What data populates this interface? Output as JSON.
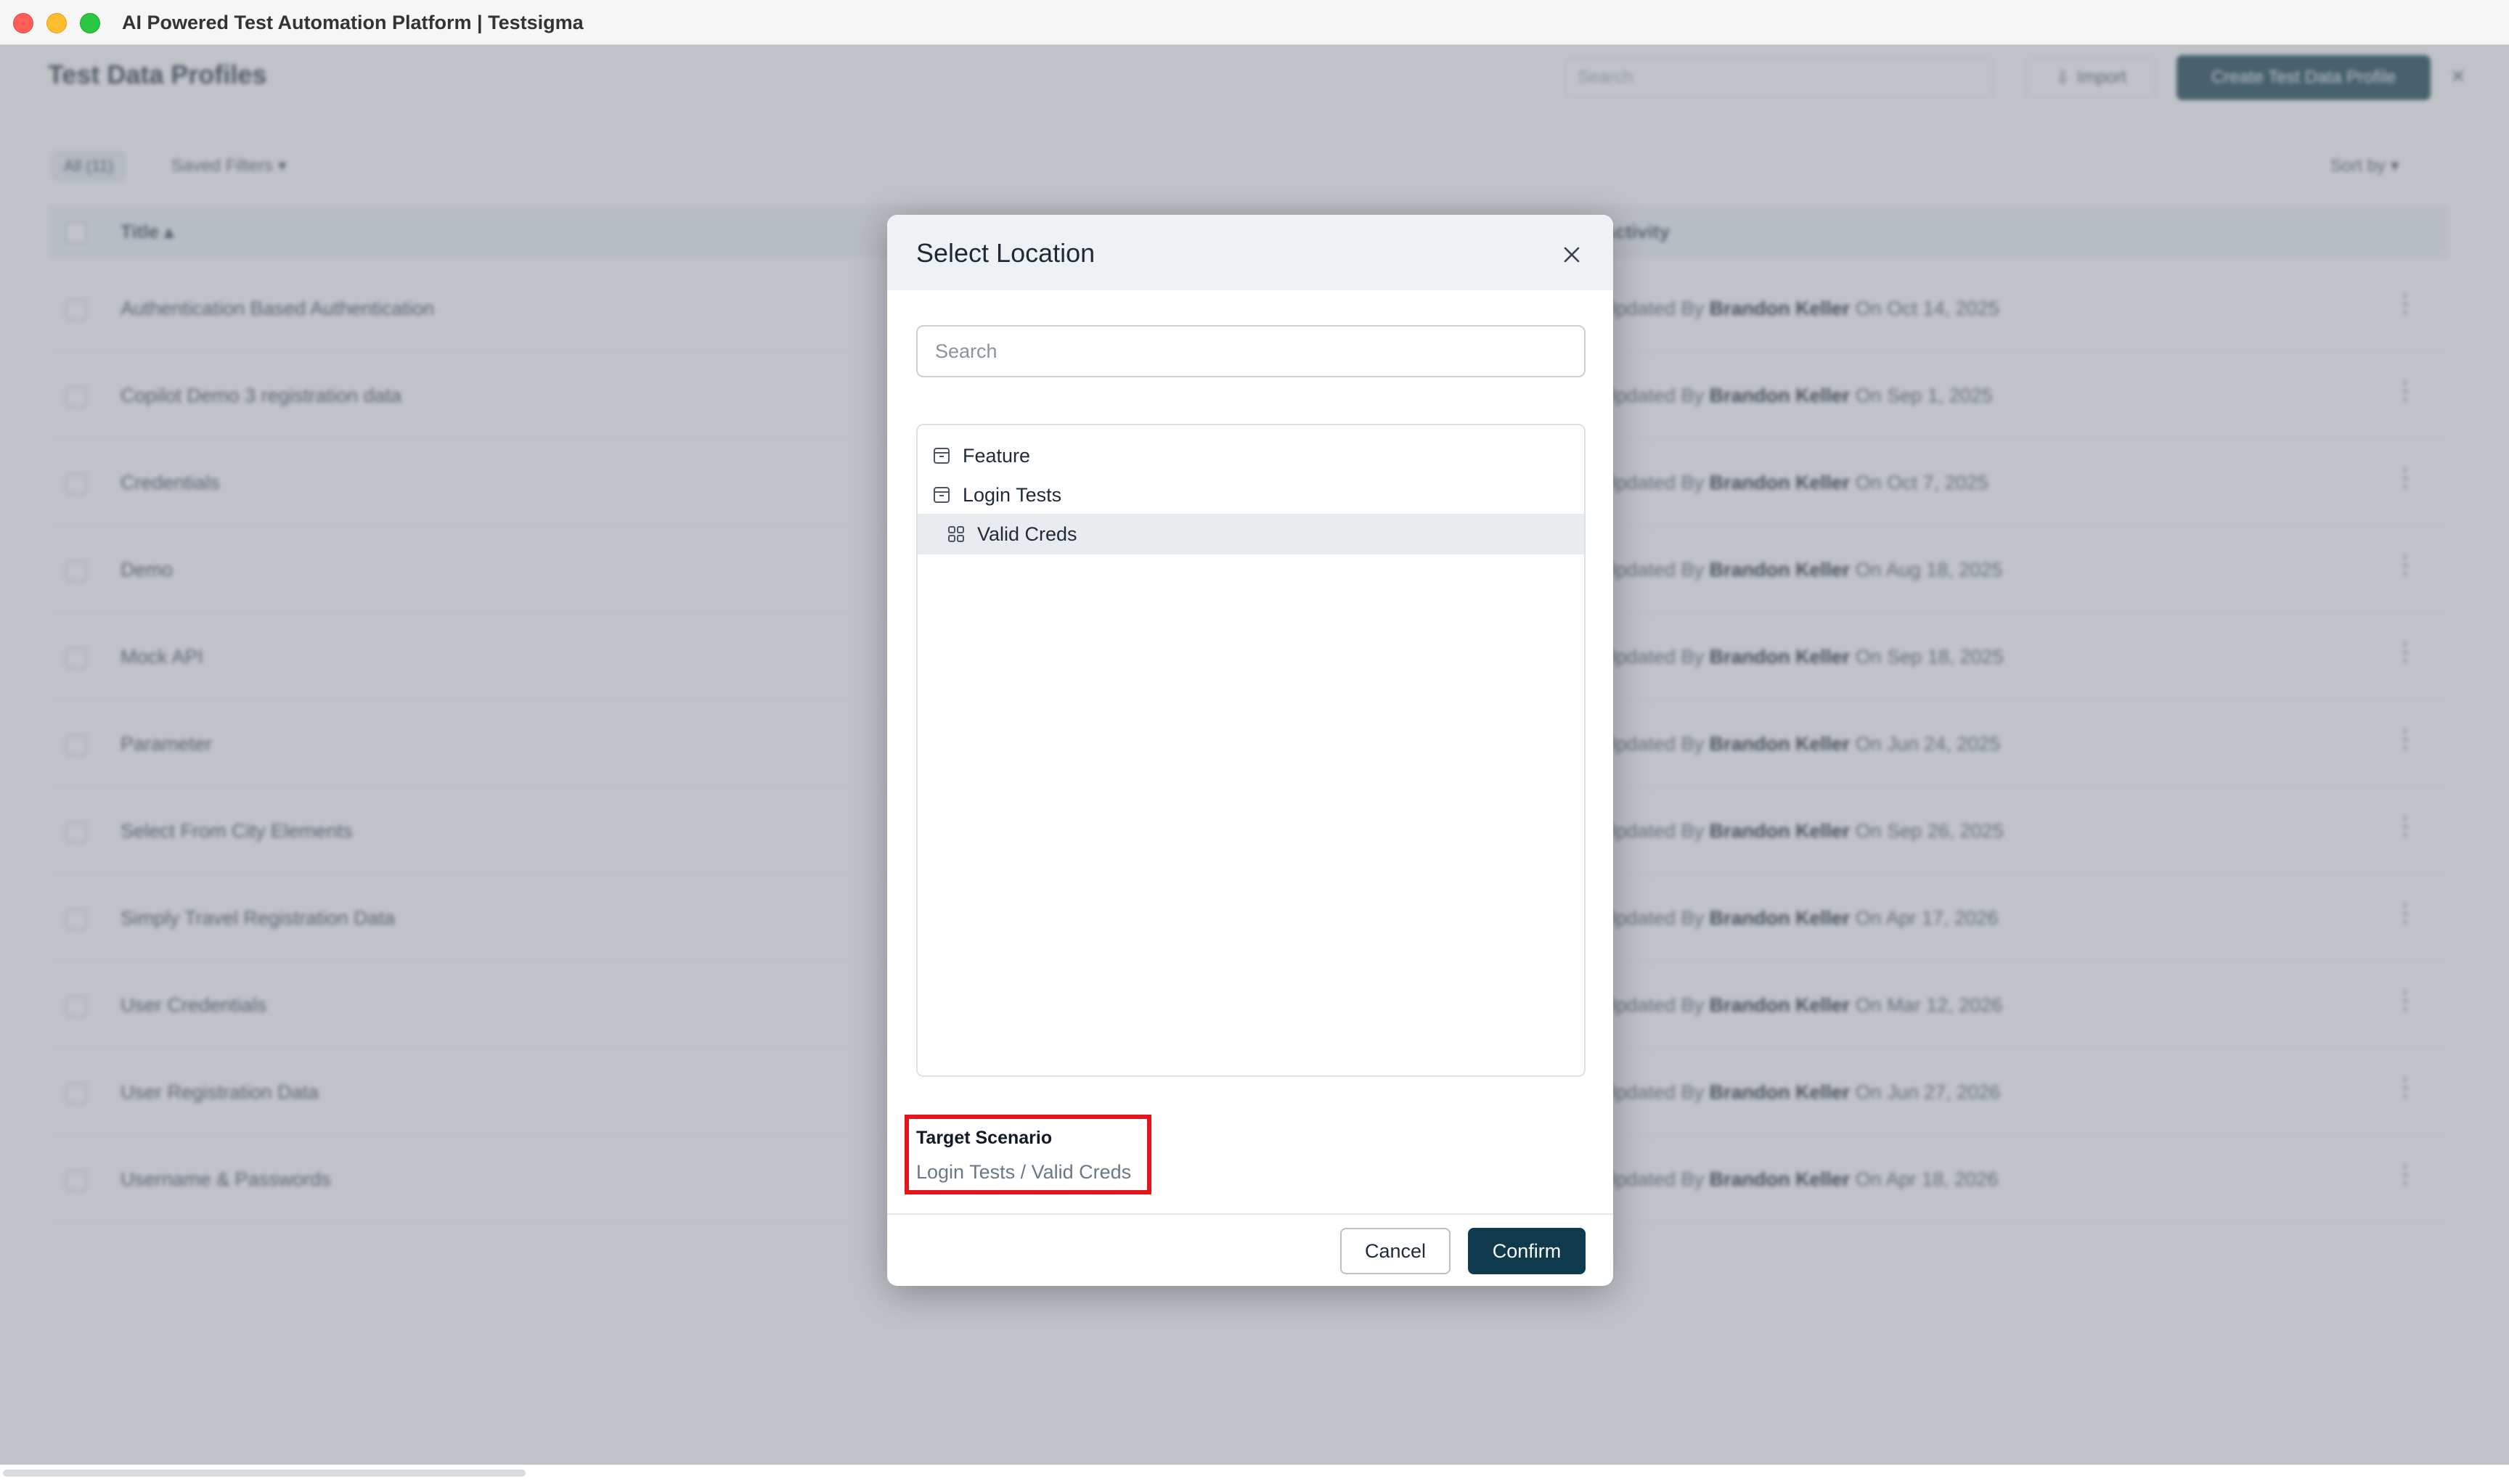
{
  "window": {
    "title": "AI Powered Test Automation Platform | Testsigma"
  },
  "background": {
    "page_title": "Test Data Profiles",
    "search_placeholder": "Search",
    "import_label": "Import",
    "create_label": "Create Test Data Profile",
    "close_symbol": "×",
    "count_badge": "All (11)",
    "saved_filters_label": "Saved Filters ▾",
    "sort_label": "Sort by ▾",
    "columns": {
      "title": "Title ▴",
      "activity": "Activity"
    },
    "rows": [
      {
        "title": "Authentication Based Authentication",
        "activity_prefix": "Updated By",
        "user": "Brandon Keller",
        "date": "On Oct 14, 2025"
      },
      {
        "title": "Copilot Demo 3 registration data",
        "activity_prefix": "Updated By",
        "user": "Brandon Keller",
        "date": "On Sep 1, 2025"
      },
      {
        "title": "Credentials",
        "activity_prefix": "Updated By",
        "user": "Brandon Keller",
        "date": "On Oct 7, 2025"
      },
      {
        "title": "Demo",
        "activity_prefix": "Updated By",
        "user": "Brandon Keller",
        "date": "On Aug 18, 2025"
      },
      {
        "title": "Mock API",
        "activity_prefix": "Updated By",
        "user": "Brandon Keller",
        "date": "On Sep 18, 2025"
      },
      {
        "title": "Parameter",
        "activity_prefix": "Updated By",
        "user": "Brandon Keller",
        "date": "On Jun 24, 2025"
      },
      {
        "title": "Select From City Elements",
        "activity_prefix": "Updated By",
        "user": "Brandon Keller",
        "date": "On Sep 26, 2025"
      },
      {
        "title": "Simply Travel Registration Data",
        "activity_prefix": "Updated By",
        "user": "Brandon Keller",
        "date": "On Apr 17, 2026"
      },
      {
        "title": "User Credentials",
        "activity_prefix": "Updated By",
        "user": "Brandon Keller",
        "date": "On Mar 12, 2026"
      },
      {
        "title": "User Registration Data",
        "activity_prefix": "Updated By",
        "user": "Brandon Keller",
        "date": "On Jun 27, 2026"
      },
      {
        "title": "Username & Passwords",
        "activity_prefix": "Updated By",
        "user": "Brandon Keller",
        "date": "On Apr 18, 2026"
      }
    ]
  },
  "modal": {
    "title": "Select Location",
    "search_placeholder": "Search",
    "tree": [
      {
        "label": "Feature",
        "icon": "feature-icon",
        "selected": false
      },
      {
        "label": "Login Tests",
        "icon": "feature-icon",
        "selected": false
      },
      {
        "label": "Valid Creds",
        "icon": "scenario-grid-icon",
        "selected": true
      }
    ],
    "target_label": "Target Scenario",
    "target_value": "Login Tests / Valid Creds",
    "cancel_label": "Cancel",
    "confirm_label": "Confirm",
    "colors": {
      "primary": "#0f3a4d",
      "highlight": "#e8141b",
      "selected_row": "#e9ecef"
    }
  }
}
